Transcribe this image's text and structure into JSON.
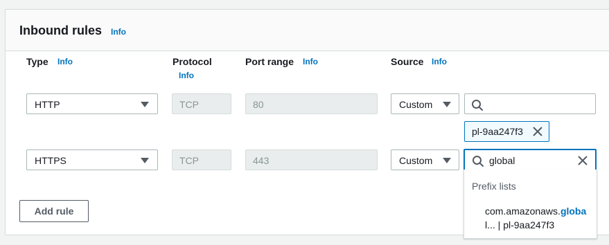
{
  "panel": {
    "title": "Inbound rules",
    "info": "Info"
  },
  "columns": {
    "type": {
      "label": "Type",
      "info": "Info"
    },
    "protocol": {
      "label": "Protocol",
      "info": "Info"
    },
    "port_range": {
      "label": "Port range",
      "info": "Info"
    },
    "source": {
      "label": "Source",
      "info": "Info"
    }
  },
  "rules": [
    {
      "type": "HTTP",
      "protocol": "TCP",
      "port_range": "80",
      "source_type": "Custom",
      "source_search": "",
      "tokens": [
        "pl-9aa247f3"
      ]
    },
    {
      "type": "HTTPS",
      "protocol": "TCP",
      "port_range": "443",
      "source_type": "Custom",
      "source_search": "global"
    }
  ],
  "dropdown": {
    "group_label": "Prefix lists",
    "option_prefix": "com.amazonaws.",
    "option_match": "globa",
    "option_suffix": "l... | pl-9aa247f3"
  },
  "add_rule_label": "Add rule",
  "icons": [
    "search-icon",
    "close-icon",
    "chevron-down-icon"
  ],
  "colors": {
    "link": "#0073bb",
    "focus": "#0073bb",
    "token_bg": "#f1faff"
  }
}
